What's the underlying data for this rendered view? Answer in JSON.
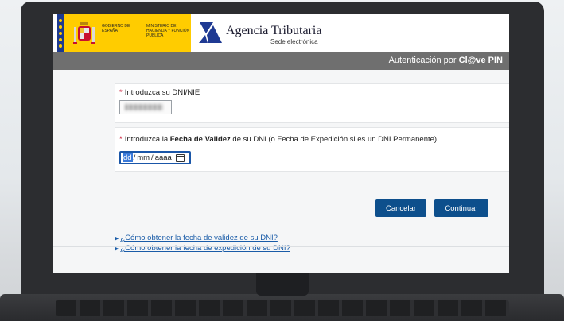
{
  "header": {
    "gov_name": "GOBIERNO DE ESPAÑA",
    "ministry_name": "MINISTERIO DE HACIENDA Y FUNCIÓN PÚBLICA",
    "agency_name": "Agencia Tributaria",
    "agency_sub": "Sede electrónica"
  },
  "auth_bar": {
    "prefix": "Autenticación por ",
    "brand": "Cl@ve PIN"
  },
  "form": {
    "dni_label": "Introduzca su DNI/NIE",
    "date_label_prefix": "Introduzca la ",
    "date_label_bold": "Fecha de Validez",
    "date_label_suffix": " de su DNI (o Fecha de Expedición si es un DNI Permanente)",
    "date_day": "dd",
    "date_month": "mm",
    "date_year": "aaaa",
    "date_sep": "/",
    "required_mark": "*"
  },
  "buttons": {
    "cancel": "Cancelar",
    "continue": "Continuar"
  },
  "links": [
    {
      "label": "¿Cómo obtener la fecha de validez de su DNI?"
    },
    {
      "label": "¿Cómo obtener la fecha de expedición de su DNI?"
    }
  ],
  "colors": {
    "brand_yellow": "#ffcc00",
    "primary_blue": "#0d4f8c",
    "link_blue": "#1a5ca8",
    "auth_bar_gray": "#6f6f6f"
  }
}
